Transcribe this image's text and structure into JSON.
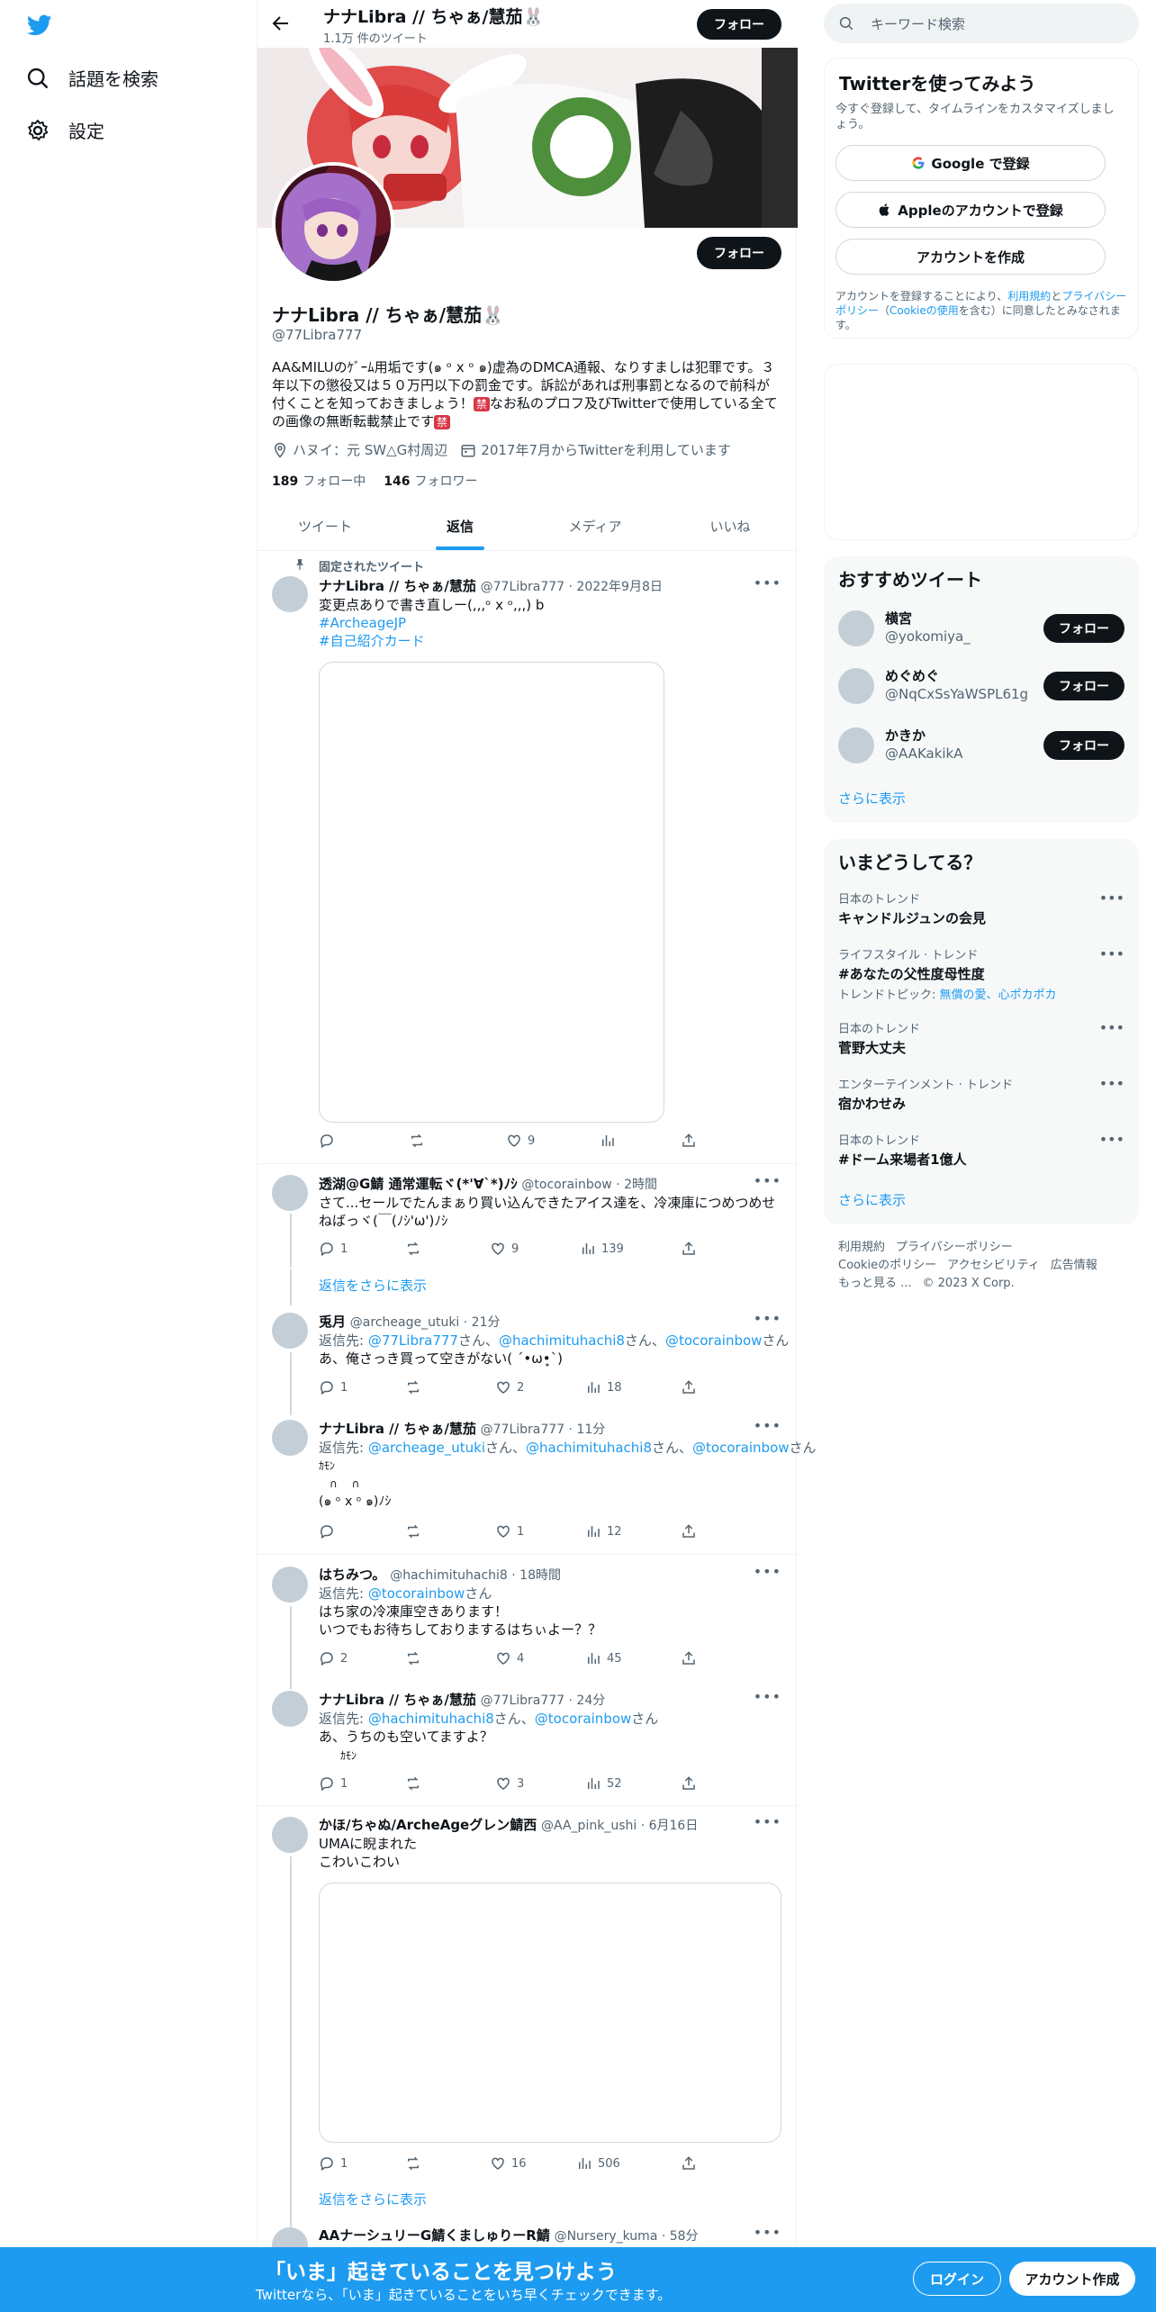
{
  "nav": {
    "search_label": "話題を検索",
    "settings_label": "設定"
  },
  "header": {
    "name": "ナナLibra // ちゃぁ/慧茄🐰",
    "tweet_count": "1.1万 件のツイート",
    "follow_label": "フォロー"
  },
  "profile": {
    "name": "ナナLibra // ちゃぁ/慧茄🐰",
    "handle": "@77Libra777",
    "follow_label": "フォロー",
    "bio_line1": "AA&MILUのｹﾞｰﾑ用垢です(๑ ᵒ x ᵒ ๑)虚為のDMCA通報、なりすましは犯罪です。３",
    "bio_line2": "年以下の懲役又は５０万円以下の罰金です。訴訟があれば刑事罰となるので前科が",
    "bio_line3a": "付くことを知っておきましょう！",
    "bio_ban": "禁",
    "bio_line3b": "なお私のプロフ及びTwitterで使用している全て",
    "bio_line4": "の画像の無断転載禁止です",
    "location": "ハヌイ：元 SW△G村周辺",
    "joined": "2017年7月からTwitterを利用しています",
    "following_count": "189",
    "following_label": "フォロー中",
    "followers_count": "146",
    "followers_label": "フォロワー"
  },
  "tabs": [
    {
      "label": "ツイート"
    },
    {
      "label": "返信"
    },
    {
      "label": "メディア"
    },
    {
      "label": "いいね"
    }
  ],
  "pinned": {
    "label": "固定されたツイート",
    "name": "ナナLibra // ちゃぁ/慧茄",
    "meta": "@77Libra777 · 2022年9月8日",
    "text": "変更点ありで書き直しー(,,,ᵒ x ᵒ,,,) b",
    "tag1": "#ArcheageJP",
    "tag2": "#自己紹介カード",
    "likes": "9"
  },
  "thread1": [
    {
      "name": "透湖@G鯖 通常運転ヾ(*'∀`*)ﾉｼ",
      "meta": "@tocorainbow · 2時間",
      "text1": "さて...セールでたんまぁり買い込んできたアイス達を、冷凍庫につめつめせ",
      "text2": "ねばっヾ(￣(ﾉｼ'ω')ﾉｼ",
      "replies": "1",
      "likes": "9",
      "views": "139"
    },
    {
      "name": "兎月",
      "meta": "@archeage_utuki · 21分",
      "reply_prefix": "返信先: ",
      "reply_to1": "@77Libra777",
      "san": "さん、",
      "reply_to2": "@hachimituhachi8",
      "reply_to3": "@tocorainbow",
      "san_end": "さん",
      "text1": "あ、俺さっき買って空きがない( ´•ω•̥`)",
      "replies": "1",
      "likes": "2",
      "views": "18"
    },
    {
      "name": "ナナLibra // ちゃぁ/慧茄",
      "meta": "@77Libra777 · 11分",
      "reply_prefix": "返信先: ",
      "reply_to1": "@archeage_utuki",
      "san": "さん、",
      "reply_to2": "@hachimituhachi8",
      "reply_to3": "@tocorainbow",
      "san_end": "さん",
      "text1": "ｶﾓﾝ",
      "text2": "　∩　 ∩",
      "text3": "(๑ ᵒ x ᵒ ๑)ﾉｼ",
      "likes": "1",
      "views": "12"
    }
  ],
  "show_replies_label": "返信をさらに表示",
  "thread2": [
    {
      "name": "はちみつ。",
      "meta": "@hachimituhachi8 · 18時間",
      "reply_prefix": "返信先: ",
      "reply_to1": "@tocorainbow",
      "san_end": "さん",
      "text1": "はち家の冷凍庫空きあります！",
      "text2": "いつでもお待ちしておりまするはちぃよー？？",
      "replies": "2",
      "likes": "4",
      "views": "45"
    },
    {
      "name": "ナナLibra // ちゃぁ/慧茄",
      "meta": "@77Libra777 · 24分",
      "reply_prefix": "返信先: ",
      "reply_to1": "@hachimituhachi8",
      "san": "さん、",
      "reply_to2": "@tocorainbow",
      "san_end": "さん",
      "text1": "あ、うちのも空いてますよ？",
      "text2": "　　ｶﾓﾝ",
      "replies": "1",
      "likes": "3",
      "views": "52"
    }
  ],
  "thread3": [
    {
      "name": "かほ/ちゃぬ/ArcheAgeグレン鯖西",
      "meta": "@AA_pink_ushi · 6月16日",
      "text1": "UMAに睨まれた",
      "text2": "こわいこわい",
      "replies": "1",
      "likes": "16",
      "views": "506"
    },
    {
      "name": "AAナーシュリーG鯖くましゅりーR鯖",
      "meta": "@Nursery_kuma · 58分"
    }
  ],
  "right": {
    "search_placeholder": "キーワード検索",
    "onboard_title": "Twitterを使ってみよう",
    "onboard_sub": "今すぐ登録して、タイムラインをカスタマイズしましょう。",
    "google_btn": "Google で登録",
    "apple_btn": "Appleのアカウントで登録",
    "create_btn": "アカウントを作成",
    "terms1": "アカウントを登録することにより、",
    "terms_link1": "利用規約",
    "terms2": "と",
    "terms_link2": "プライバシーポリシー",
    "terms3": "（",
    "terms_link3": "Cookieの使用",
    "terms4": "を含む）に同意したとみなされます。",
    "rec_title": "おすすめツイート",
    "rec": [
      {
        "name": "横宮",
        "handle": "@yokomiya_",
        "btn": "フォロー"
      },
      {
        "name": "めぐめぐ",
        "handle": "@NqCxSsYaWSPL61g",
        "btn": "フォロー"
      },
      {
        "name": "かきか",
        "handle": "@AAKakikA",
        "btn": "フォロー"
      }
    ],
    "show_more": "さらに表示",
    "trend_title": "いまどうしてる？",
    "trends": [
      {
        "cat": "日本のトレンド",
        "title": "キャンドルジュンの会見"
      },
      {
        "cat": "ライフスタイル · トレンド",
        "title": "#あなたの父性度母性度",
        "sub_prefix": "トレンドトピック: ",
        "sub_link": "無償の愛、心ポカポカ"
      },
      {
        "cat": "日本のトレンド",
        "title": "菅野大丈夫"
      },
      {
        "cat": "エンターテインメント · トレンド",
        "title": "宿かわせみ"
      },
      {
        "cat": "日本のトレンド",
        "title": "#ドーム来場者1億人"
      }
    ],
    "footer": {
      "l1": "利用規約",
      "l2": "プライバシーポリシー",
      "l3": "Cookieのポリシー",
      "l4": "アクセシビリティ",
      "l5": "広告情報",
      "l6": "もっと見る ...",
      "l7": "© 2023 X Corp."
    }
  },
  "bottom": {
    "title": "「いま」起きていることを見つけよう",
    "sub": "Twitterなら、「いま」起きていることをいち早くチェックできます。",
    "login": "ログイン",
    "signup": "アカウント作成"
  }
}
